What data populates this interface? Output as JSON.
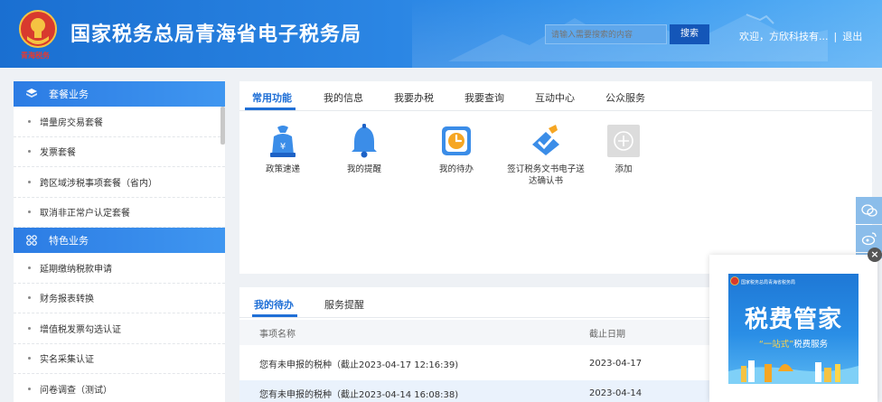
{
  "header": {
    "emblem_sub": "青海税务",
    "title": "国家税务总局青海省电子税务局",
    "search_placeholder": "请输入需要搜索的内容",
    "search_button": "搜索",
    "welcome": "欢迎，方欣科技有...",
    "separator": "|",
    "logout": "退出"
  },
  "sidebar": {
    "sections": [
      {
        "title": "套餐业务",
        "icon": "package-icon",
        "items": [
          "增量房交易套餐",
          "发票套餐",
          "跨区域涉税事项套餐（省内）",
          "取消非正常户认定套餐"
        ]
      },
      {
        "title": "特色业务",
        "icon": "grid-icon",
        "items": [
          "延期缴纳税款申请",
          "财务报表转换",
          "增值税发票勾选认证",
          "实名采集认证",
          "问卷调查（测试）"
        ]
      }
    ]
  },
  "top_tabs": [
    "常用功能",
    "我的信息",
    "我要办税",
    "我要查询",
    "互动中心",
    "公众服务"
  ],
  "functions": [
    {
      "label": "政策速递",
      "icon": "policy-bag-icon"
    },
    {
      "label": "我的提醒",
      "icon": "bell-icon"
    },
    {
      "label": "我的待办",
      "icon": "clock-icon"
    },
    {
      "label": "签订税务文书电子送达确认书",
      "icon": "sign-check-icon"
    },
    {
      "label": "添加",
      "icon": "plus-icon"
    }
  ],
  "bottom_tabs": [
    "我的待办",
    "服务提醒"
  ],
  "todo_table": {
    "headers": [
      "事项名称",
      "截止日期"
    ],
    "rows": [
      [
        "您有未申报的税种（截止2023-04-17 12:16:39)",
        "2023-04-17"
      ],
      [
        "您有未申报的税种（截止2023-04-14 16:08:38)",
        "2023-04-14"
      ]
    ]
  },
  "ad": {
    "top_text": "国家税务总局青海省税务局",
    "big_text": "税费管家",
    "small_highlight": "“一站式”",
    "small_text": "税费服务"
  },
  "popup_close": "×",
  "colors": {
    "primary": "#1f6fd6",
    "header_start": "#1a6fd1",
    "header_end": "#5bb1f5"
  }
}
